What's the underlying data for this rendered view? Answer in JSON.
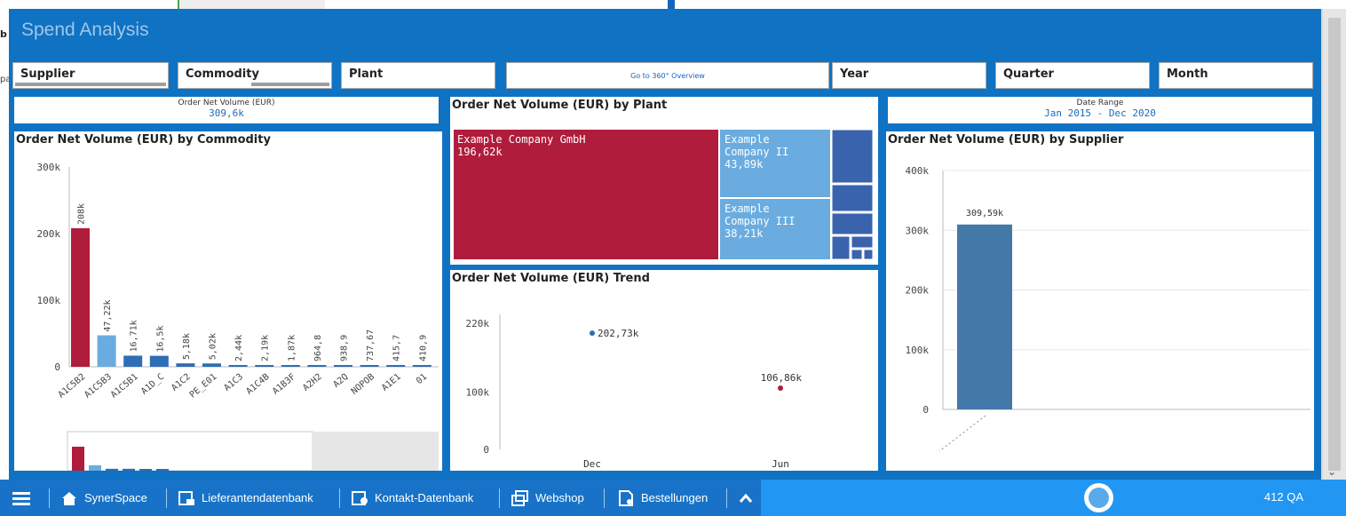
{
  "left_stub": {
    "b": "b",
    "pal": "pal"
  },
  "title": "Spend Analysis",
  "filters": [
    {
      "label": "Supplier"
    },
    {
      "label": "Commodity"
    },
    {
      "label": "Plant"
    },
    {
      "label": "Year"
    },
    {
      "label": "Quarter"
    },
    {
      "label": "Month"
    }
  ],
  "goto_button": "Go to 360° Overview",
  "kpi_volume": {
    "label": "Order Net Volume (EUR)",
    "value": "309,6k"
  },
  "kpi_date": {
    "label": "Date Range",
    "value": "Jan 2015 - Dec 2020"
  },
  "panels": {
    "commodity": "Order Net Volume (EUR) by Commodity",
    "plant": "Order Net Volume (EUR) by Plant",
    "trend": "Order Net Volume (EUR) Trend",
    "supplier": "Order Net Volume (EUR) by Supplier"
  },
  "colors": {
    "accent_red": "#b01c3c",
    "light_blue": "#6aacdf",
    "mid_blue": "#2f6db5",
    "steel_blue": "#4478a8"
  },
  "chart_data": [
    {
      "type": "bar",
      "title": "Order Net Volume (EUR) by Commodity",
      "categories": [
        "A1C5B2",
        "A1C5B3",
        "A1C5B1",
        "A1D_C",
        "A1C2",
        "PE_E01",
        "A1C3",
        "A1C4B",
        "A1B3F",
        "A2H2",
        "A2Q",
        "NOPOB",
        "A1E1",
        "01"
      ],
      "values": [
        208000,
        47220,
        16710,
        16500,
        5180,
        5020,
        2440,
        2190,
        1870,
        964.8,
        938.9,
        737.67,
        415.7,
        410.9
      ],
      "labels": [
        "208k",
        "47,22k",
        "16,71k",
        "16,5k",
        "5,18k",
        "5,02k",
        "2,44k",
        "2,19k",
        "1,87k",
        "964,8",
        "938,9",
        "737,67",
        "415,7",
        "410,9"
      ],
      "yticks": [
        "0",
        "100k",
        "200k",
        "300k"
      ],
      "ylim": [
        0,
        300000
      ]
    },
    {
      "type": "treemap",
      "title": "Order Net Volume (EUR) by Plant",
      "items": [
        {
          "name": "Example Company GmbH",
          "label": "196,62k",
          "value": 196620
        },
        {
          "name": "Example Company II",
          "label": "43,89k",
          "value": 43890
        },
        {
          "name": "Example Company III",
          "label": "38,21k",
          "value": 38210
        }
      ]
    },
    {
      "type": "scatter",
      "title": "Order Net Volume (EUR) Trend",
      "categories": [
        "Dec",
        "Jun"
      ],
      "values": [
        202730,
        106860
      ],
      "labels": [
        "202,73k",
        "106,86k"
      ],
      "yticks": [
        "0",
        "100k",
        "220k"
      ],
      "ylim": [
        0,
        220000
      ]
    },
    {
      "type": "bar",
      "title": "Order Net Volume (EUR) by Supplier",
      "categories": [
        ""
      ],
      "values": [
        309590
      ],
      "labels": [
        "309,59k"
      ],
      "yticks": [
        "0",
        "100k",
        "200k",
        "300k",
        "400k"
      ],
      "ylim": [
        0,
        400000
      ]
    }
  ],
  "taskbar": {
    "items": [
      "SynerSpace",
      "Lieferantendatenbank",
      "Kontakt-Datenbank",
      "Webshop",
      "Bestellungen"
    ],
    "right": "412 QA"
  }
}
